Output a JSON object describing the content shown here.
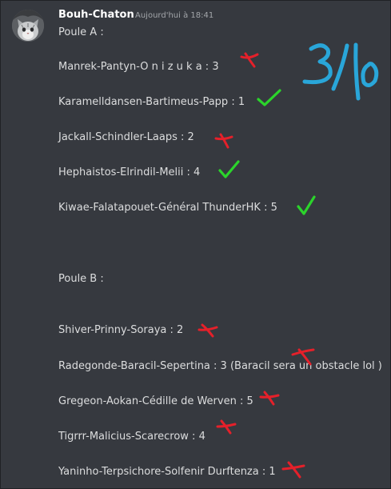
{
  "message": {
    "author": "Bouh-Chaton",
    "timestamp": "Aujourd'hui à 18:41",
    "avatar": "cat-avatar"
  },
  "poule_a": {
    "title": "Poule A :",
    "entries": [
      {
        "text": "Manrek-Pantyn-O n i z u k a : 3",
        "mark": "red-cross"
      },
      {
        "text": "Karamelldansen-Bartimeus-Papp : 1",
        "mark": "green-check"
      },
      {
        "text": "Jackall-Schindler-Laaps : 2",
        "mark": "red-cross"
      },
      {
        "text": "Hephaistos-Elrindil-Melii : 4",
        "mark": "green-check"
      },
      {
        "text": "Kiwae-Falatapouet-Général ThunderHK : 5",
        "mark": "green-check"
      }
    ]
  },
  "poule_b": {
    "title": "Poule B :",
    "entries": [
      {
        "text": "Shiver-Prinny-Soraya : 2",
        "mark": "red-cross"
      },
      {
        "text": "Radegonde-Baracil-Sepertina : 3 (Baracil sera un obstacle lol )",
        "mark": "red-cross"
      },
      {
        "text": "Gregeon-Aokan-Cédille de Werven : 5",
        "mark": "red-cross"
      },
      {
        "text": "Tigrrr-Malicius-Scarecrow : 4",
        "mark": "red-cross"
      },
      {
        "text": "Yaninho-Terpsichore-Solfenir Durftenza : 1",
        "mark": "red-cross"
      }
    ]
  },
  "annotation": {
    "score": "3/10",
    "color": "#29a6d9"
  },
  "colors": {
    "background": "#36393f",
    "text": "#dcddde",
    "username": "#ffffff",
    "timestamp": "#a3a6aa",
    "cross": "#e5202a",
    "check": "#2bd42b"
  }
}
